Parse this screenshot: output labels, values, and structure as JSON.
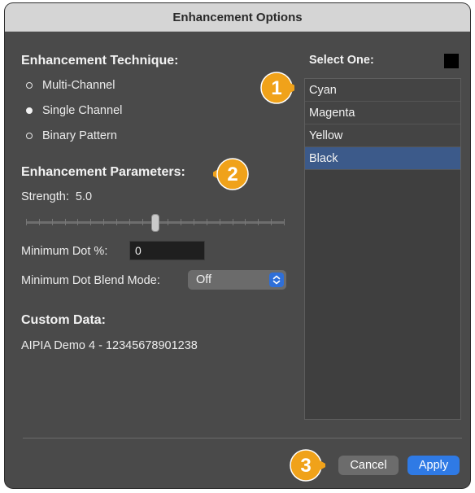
{
  "window": {
    "title": "Enhancement Options"
  },
  "technique": {
    "heading": "Enhancement Technique:",
    "options": [
      {
        "label": "Multi-Channel",
        "selected": false
      },
      {
        "label": "Single Channel",
        "selected": true
      },
      {
        "label": "Binary Pattern",
        "selected": false
      }
    ]
  },
  "parameters": {
    "heading": "Enhancement Parameters:",
    "strength_label": "Strength:",
    "strength_value": "5.0",
    "strength_fraction": 0.5,
    "min_dot_label": "Minimum Dot %:",
    "min_dot_value": "0",
    "blend_label": "Minimum Dot Blend Mode:",
    "blend_value": "Off"
  },
  "custom": {
    "heading": "Custom Data:",
    "value": "AIPIA Demo 4 - 12345678901238"
  },
  "channels": {
    "heading": "Select One:",
    "swatch_color": "#000000",
    "items": [
      {
        "label": "Cyan",
        "selected": false
      },
      {
        "label": "Magenta",
        "selected": false
      },
      {
        "label": "Yellow",
        "selected": false
      },
      {
        "label": "Black",
        "selected": true
      }
    ]
  },
  "buttons": {
    "cancel": "Cancel",
    "apply": "Apply"
  },
  "callouts": {
    "one": "1",
    "two": "2",
    "three": "3",
    "color": "#f0a21a"
  }
}
